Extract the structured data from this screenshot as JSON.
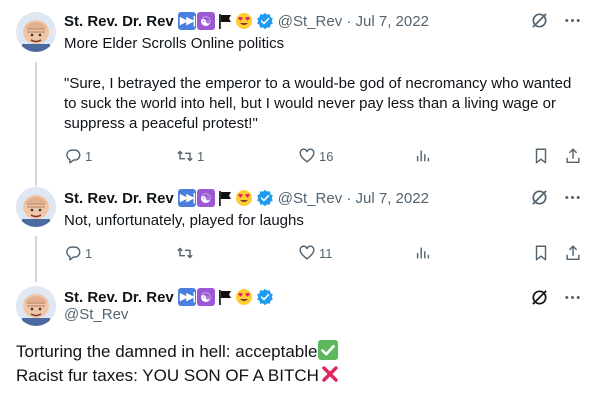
{
  "colors": {
    "text": "#0f1419",
    "muted": "#536471",
    "thread_line": "#cfd9de",
    "verified": "#1d9bf0",
    "check": "#5cb85c",
    "cross": "#e0245e"
  },
  "author": {
    "name": "St. Rev. Dr. Rev",
    "handle": "@St_Rev",
    "name_emojis": [
      "next-track-emoji",
      "yin-yang-emoji",
      "black-flag-emoji",
      "heart-eyes-emoji"
    ],
    "verified": true
  },
  "tweets": [
    {
      "meta": "@St_Rev · Jul 7, 2022",
      "text_line1": "More Elder Scrolls Online politics",
      "text_quote": "\"Sure, I betrayed the emperor to a would-be god of necromancy who wanted to suck the world into hell, but I would never pay less than a living wage or suppress a peaceful protest!\"",
      "replies": "1",
      "retweets": "1",
      "likes": "16"
    },
    {
      "meta": "@St_Rev · Jul 7, 2022",
      "text_line1": "Not, unfortunately, played for laughs",
      "replies": "1",
      "retweets": "",
      "likes": "11"
    }
  ],
  "main_tweet": {
    "handle": "@St_Rev",
    "line1": "Torturing the damned in hell: acceptable",
    "line2": "Racist fur taxes: YOU SON OF A BITCH"
  }
}
